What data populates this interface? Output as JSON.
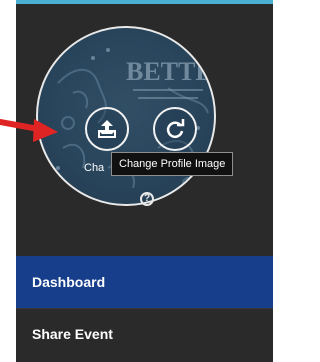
{
  "profile": {
    "upload_button_icon": "upload-icon",
    "reset_button_icon": "refresh-icon",
    "caption_text": "Cha",
    "help_icon": "question-circle-icon",
    "tooltip_text": "Change Profile Image"
  },
  "avatar_artwork": {
    "visible_word": "BETTER"
  },
  "nav": {
    "items": [
      {
        "label": "Dashboard",
        "active": true
      },
      {
        "label": "Share Event",
        "active": false
      }
    ]
  },
  "colors": {
    "sidebar_bg": "#2a2a2a",
    "active_item_bg": "#163e8a",
    "top_strip": "#4ab0d4",
    "annotation_arrow": "#e02424"
  },
  "annotation": {
    "arrow_icon": "red-arrow-annotation"
  }
}
